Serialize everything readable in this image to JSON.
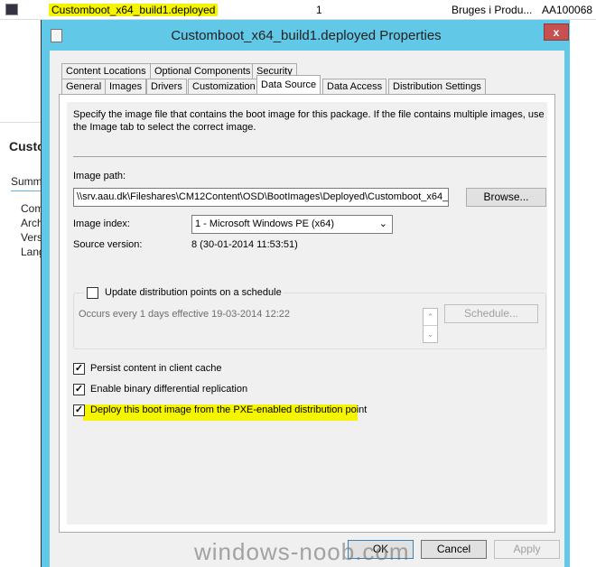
{
  "list_row": {
    "name": "Customboot_x64_build1.deployed",
    "count": "1",
    "location": "Bruges i Produ...",
    "id": "AA100068",
    "icon": "boot-image-icon"
  },
  "background_pane": {
    "title": "Custo",
    "tab": "Summ",
    "fields": [
      "Com",
      "Arch",
      "Vers",
      "Lang"
    ]
  },
  "dialog": {
    "title": "Customboot_x64_build1.deployed Properties",
    "close_label": "x",
    "tabs_row1": [
      "Content Locations",
      "Optional Components",
      "Security"
    ],
    "tabs_row2": [
      "General",
      "Images",
      "Drivers",
      "Customization",
      "Data Source",
      "Data Access",
      "Distribution Settings"
    ],
    "active_tab": "Data Source",
    "description": "Specify the image file that contains the boot image for this package. If the file contains multiple images, use the Image tab to select the correct image.",
    "image_path_label": "Image path:",
    "image_path_value": "\\\\srv.aau.dk\\Fileshares\\CM12Content\\OSD\\BootImages\\Deployed\\Customboot_x64_",
    "browse_label": "Browse...",
    "image_index_label": "Image index:",
    "image_index_value": "1 - Microsoft Windows PE (x64)",
    "source_version_label": "Source version:",
    "source_version_value": "8 (30-01-2014 11:53:51)",
    "schedule_checkbox": {
      "label": "Update distribution points on a schedule",
      "checked": false
    },
    "schedule_text": "Occurs every 1 days effective 19-03-2014 12:22",
    "schedule_button": "Schedule...",
    "checkboxes": [
      {
        "label": "Persist content in client cache",
        "checked": true
      },
      {
        "label": "Enable binary differential replication",
        "checked": true
      },
      {
        "label": "Deploy this boot image from the PXE-enabled distribution point",
        "checked": true,
        "highlighted": true
      }
    ],
    "buttons": {
      "ok": "OK",
      "cancel": "Cancel",
      "apply": "Apply"
    }
  },
  "watermark": "windows-noob.com",
  "colors": {
    "frame": "#62c8e8",
    "close": "#c75050",
    "highlight": "#f5f500"
  }
}
